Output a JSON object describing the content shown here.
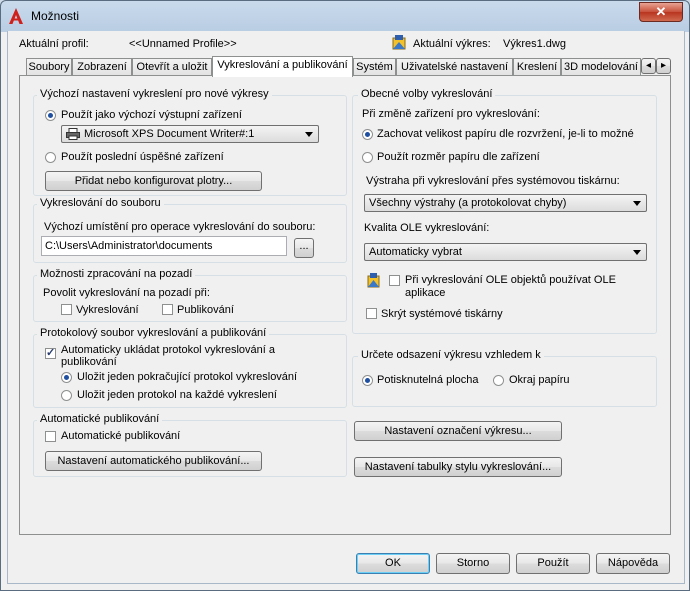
{
  "window": {
    "title": "Možnosti",
    "close_symbol": "✕"
  },
  "header": {
    "profile_label": "Aktuální profil:",
    "profile_value": "<<Unnamed Profile>>",
    "drawing_label": "Aktuální výkres:",
    "drawing_value": "Výkres1.dwg"
  },
  "tabs": [
    {
      "label": "Soubory"
    },
    {
      "label": "Zobrazení"
    },
    {
      "label": "Otevřít a uložit"
    },
    {
      "label": "Vykreslování a publikování"
    },
    {
      "label": "Systém"
    },
    {
      "label": "Uživatelské nastavení"
    },
    {
      "label": "Kreslení"
    },
    {
      "label": "3D modelování"
    }
  ],
  "tab_scroll": {
    "left": "◂",
    "right": "▸"
  },
  "default_output": {
    "title": "Výchozí nastavení vykreslení pro nové výkresy",
    "radio_default_device": "Použít jako výchozí výstupní zařízení",
    "device_select": "Microsoft XPS Document Writer#:1",
    "radio_last_device": "Použít poslední úspěšné zařízení",
    "add_plotter_button": "Přidat nebo konfigurovat plotry..."
  },
  "plot_to_file": {
    "title": "Vykreslování do souboru",
    "location_label": "Výchozí umístění pro operace vykreslování do souboru:",
    "location_value": "C:\\Users\\Administrator\\documents",
    "browse_button": "..."
  },
  "background": {
    "title": "Možnosti zpracování na pozadí",
    "enable_label": "Povolit vykreslování na pozadí při:",
    "plotting": "Vykreslování",
    "publishing": "Publikování"
  },
  "log": {
    "title": "Protokolový soubor vykreslování a publikování",
    "auto_save": "Automaticky ukládat protokol vykreslování a publikování",
    "continuous": "Uložit jeden pokračující protokol vykreslování",
    "per_plot": "Uložit jeden protokol na každé vykreslení"
  },
  "auto_publish": {
    "title": "Automatické publikování",
    "checkbox": "Automatické publikování",
    "settings_button": "Nastavení automatického publikování..."
  },
  "general": {
    "title": "Obecné volby vykreslování",
    "device_change_label": "Při změně zařízení pro vykreslování:",
    "keep_paper": "Zachovat velikost papíru dle rozvržení, je-li to možné",
    "use_device_paper": "Použít rozměr papíru dle zařízení",
    "warning_label": "Výstraha při vykreslování přes systémovou tiskárnu:",
    "warning_select": "Všechny výstrahy (a protokolovat chyby)",
    "ole_quality_label": "Kvalita OLE vykreslování:",
    "ole_quality_select": "Automaticky vybrat",
    "ole_app": "Při vykreslování OLE objektů používat OLE aplikace",
    "hide_printers": "Skrýt systémové tiskárny"
  },
  "offset": {
    "title": "Určete odsazení výkresu vzhledem k",
    "printable_area": "Potisknutelná plocha",
    "paper_edge": "Okraj papíru"
  },
  "stamp_button": "Nastavení označení výkresu...",
  "style_table_button": "Nastavení tabulky stylu vykreslování...",
  "footer": {
    "ok": "OK",
    "cancel": "Storno",
    "apply": "Použít",
    "help": "Nápověda"
  }
}
